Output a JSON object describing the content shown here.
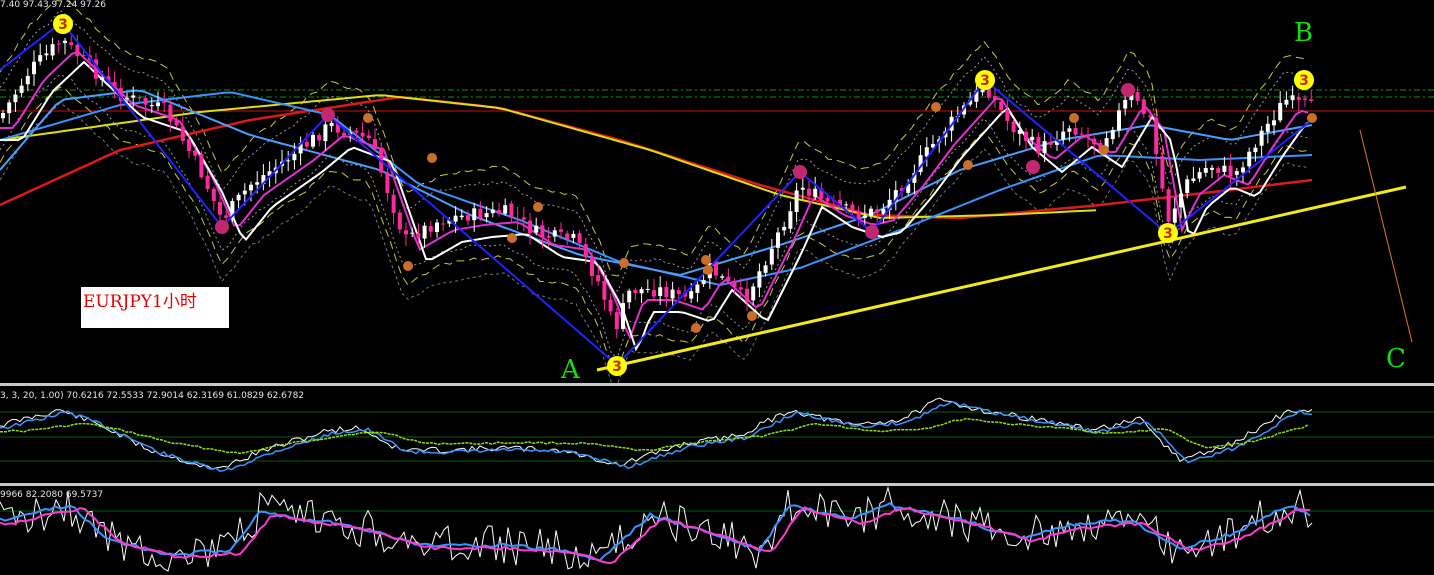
{
  "chart_data": {
    "type": "line",
    "symbol_label": "EURJPY1小时",
    "wave_labels": {
      "a": "A",
      "b": "B",
      "c": "C"
    },
    "main_header": "7.40 97.43 97.24 97.26",
    "osc1_header": "3, 3, 20, 1.00) 70.6216 72.5533 72.9014 62.3169 61.0829 62.6782",
    "osc2_header": "9966 82.2080 69.5737",
    "pivot_markers": [
      "3",
      "3",
      "3",
      "3",
      "3"
    ],
    "colors": {
      "background": "#000000",
      "bull_candle": "#ffffff",
      "bear_candle": "#ff2aa0",
      "zigzag": "#2222ff",
      "trendline": "#f2ea1a",
      "resistance": "#cc1111",
      "ma_red": "#d91a1a",
      "ma_yellow": "#dede10",
      "ma_blue": "#3a93ff",
      "ma_magenta": "#e030d0",
      "ma_white": "#ffffff",
      "wave_label": "#10e010",
      "marker_yellow": "#ffff00",
      "osc_white": "#ffffff",
      "osc_blue": "#3a93ff",
      "osc_magenta": "#ff3ad0",
      "osc_green": "#8fe010"
    }
  }
}
